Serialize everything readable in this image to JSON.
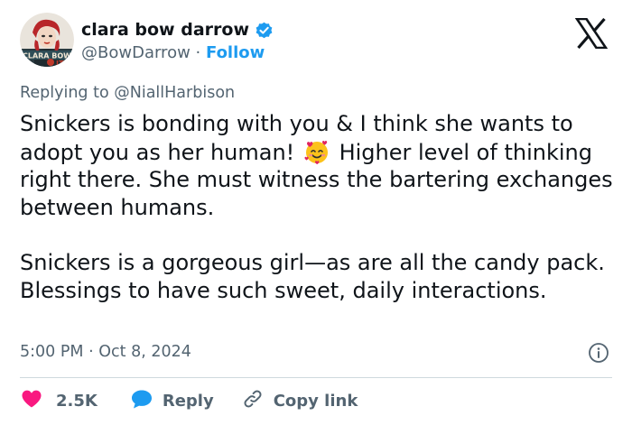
{
  "author": {
    "display_name": "clara bow darrow",
    "handle": "@BowDarrow",
    "separator": "·",
    "follow_label": "Follow",
    "avatar_text": "CLARA BOW"
  },
  "reply_context": {
    "prefix": "Replying to",
    "mention": "@NiallHarbison"
  },
  "tweet": {
    "paragraph1_part1": "Snickers is bonding with you & I think she wants to adopt you as her human!",
    "emoji": "smiling-face-with-hearts",
    "paragraph1_part2": "Higher level of thinking right there. She must witness the bartering exchanges between humans.",
    "paragraph2": "Snickers is a gorgeous girl—as are all the candy pack. Blessings to have such sweet, daily interactions."
  },
  "meta": {
    "time": "5:00 PM",
    "separator": "·",
    "date": "Oct 8, 2024"
  },
  "actions": {
    "like_count": "2.5K",
    "reply_label": "Reply",
    "copy_label": "Copy link"
  },
  "colors": {
    "accent": "#1d9bf0",
    "like": "#f91880",
    "secondary_text": "#536471",
    "primary_text": "#0f1419",
    "divider": "#cfd9de"
  }
}
